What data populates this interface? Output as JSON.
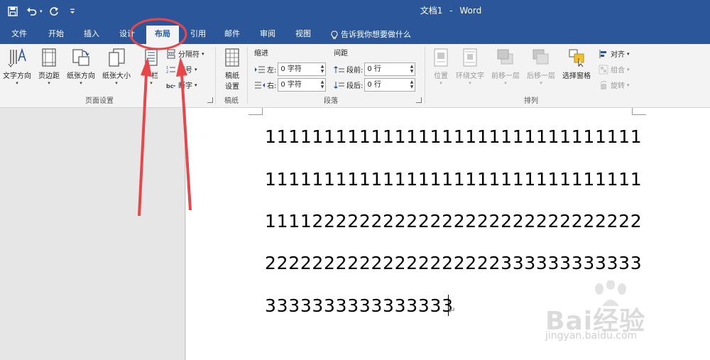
{
  "app": {
    "doc_name": "文档1",
    "separator": "-",
    "app_name": "Word"
  },
  "colors": {
    "accent": "#2b579a",
    "annotation": "#e8474a"
  },
  "tabs": [
    {
      "label": "文件"
    },
    {
      "label": "开始"
    },
    {
      "label": "插入"
    },
    {
      "label": "设计"
    },
    {
      "label": "布局",
      "active": true
    },
    {
      "label": "引用"
    },
    {
      "label": "邮件"
    },
    {
      "label": "审阅"
    },
    {
      "label": "视图"
    }
  ],
  "tell_me": {
    "label": "告诉我你想要做什么",
    "icon": "lightbulb-icon"
  },
  "page_setup": {
    "group_label": "页面设置",
    "text_direction": "文字方向",
    "margins": "页边距",
    "orientation": "纸张方向",
    "size": "纸张大小",
    "columns": "栏",
    "breaks": "分隔符",
    "line_numbers": "行号",
    "hyphenation": "断字"
  },
  "manuscript": {
    "group_label": "稿纸",
    "label_line1": "稿纸",
    "label_line2": "设置"
  },
  "paragraph": {
    "group_label": "段落",
    "indent_header": "缩进",
    "spacing_header": "间距",
    "left_label": "左:",
    "left_value": "0 字符",
    "right_label": "右:",
    "right_value": "0 字符",
    "before_label": "段前:",
    "before_value": "0 行",
    "after_label": "段后:",
    "after_value": "0 行"
  },
  "arrange": {
    "group_label": "排列",
    "position": "位置",
    "wrap_text": "环绕文字",
    "bring_forward": "前移一层",
    "send_backward": "后移一层",
    "selection_pane": "选择窗格",
    "align": "对齐",
    "group": "组合",
    "rotate": "旋转"
  },
  "document": {
    "lines": [
      "11111111111111111111111111111111",
      "11111111111111111111111111111111",
      "11112222222222222222222222222222",
      "22222222222222222222333333333333",
      "3333333333333333"
    ]
  },
  "watermark": {
    "brand": "Bai经验",
    "url": "jingyan.baidu.com"
  }
}
